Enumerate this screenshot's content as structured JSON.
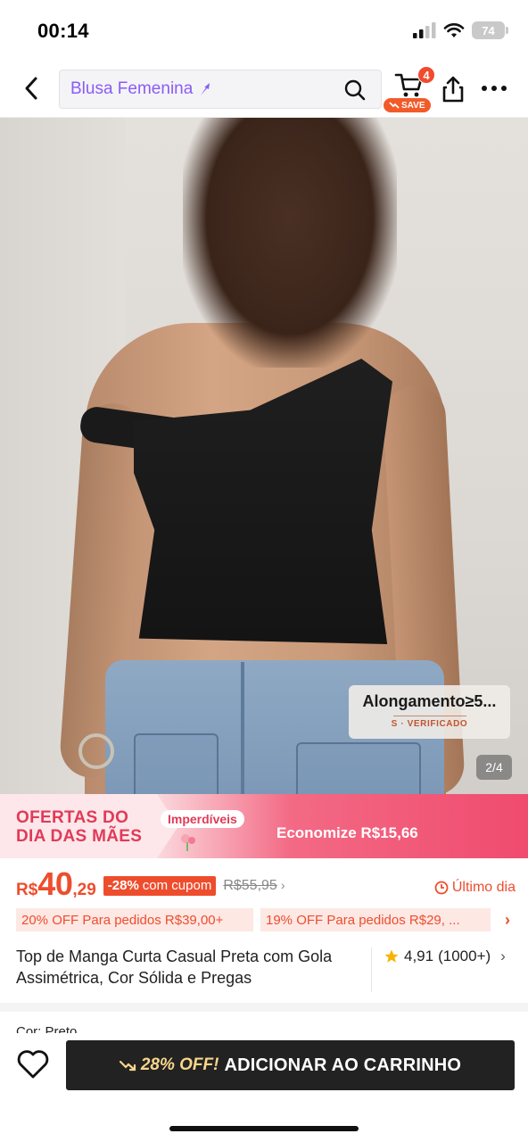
{
  "status_bar": {
    "time": "00:14",
    "battery": "74"
  },
  "header": {
    "search_text": "Blusa Femenina",
    "cart_count": "4",
    "save_label": "SAVE"
  },
  "gallery": {
    "tag_title": "Alongamento≥5...",
    "tag_sub": "S · VERIFICADO",
    "counter": "2/4"
  },
  "promo": {
    "title_line1": "OFERTAS DO",
    "title_line2": "DIA DAS MÃES",
    "tag": "Imperdíveis",
    "savings": "Economize R$15,66"
  },
  "price": {
    "currency": "R$",
    "main": "40",
    "cents": ",29",
    "discount_pct": "-28%",
    "discount_text": "com cupom",
    "old_price": "R$55,95",
    "last_day": "Último dia"
  },
  "coupons": [
    "20% OFF Para pedidos R$39,00+",
    "19% OFF Para pedidos R$29, ..."
  ],
  "product": {
    "title": "Top de Manga Curta Casual Preta com Gola Assimétrica, Cor Sólida e Pregas",
    "rating": "4,91",
    "reviews": "(1000+)"
  },
  "variant": {
    "color_label": "Cor: Preto"
  },
  "bottom_bar": {
    "discount": "28% OFF!",
    "add_to_cart": "ADICIONAR AO CARRINHO"
  },
  "colors": {
    "accent": "#ee4d2d",
    "search_text": "#8a5cf6",
    "promo_pink": "#f04b6f",
    "button_dark": "#222222",
    "discount_gold": "#f7d58b"
  }
}
